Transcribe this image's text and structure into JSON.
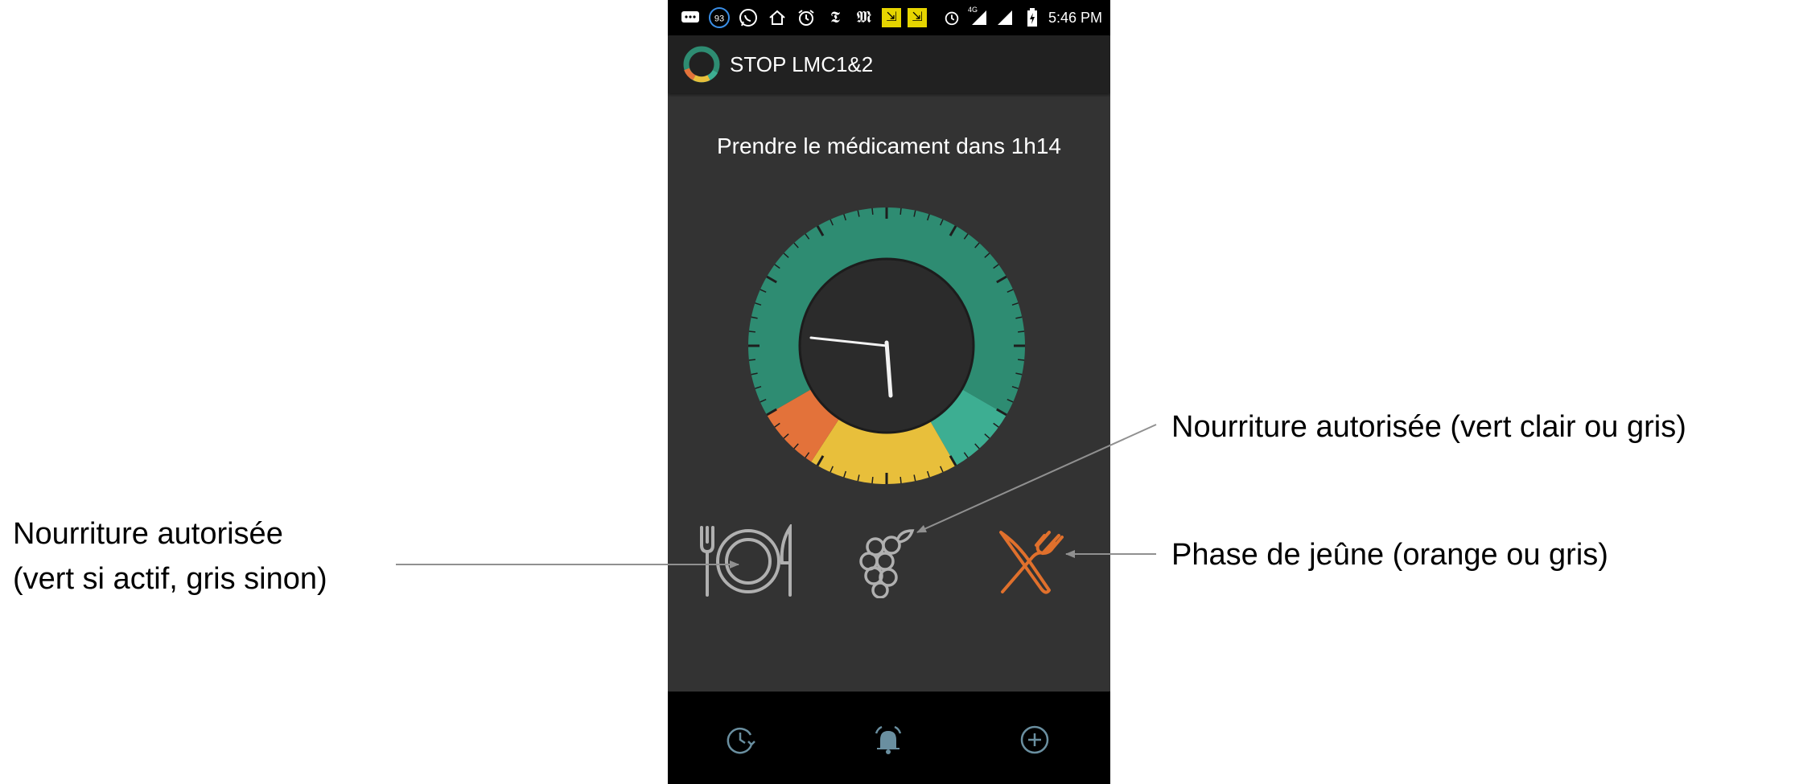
{
  "status_bar": {
    "notification_badge": "93",
    "time": "5:46 PM",
    "network": "4G"
  },
  "app_bar": {
    "title": "STOP LMC1&2"
  },
  "countdown_text": "Prendre le médicament dans 1h14",
  "food_icons": [
    {
      "icon": "plate-fork-knife-icon",
      "state": "gris",
      "color": "#b0b0b0"
    },
    {
      "icon": "grapes-icon",
      "state": "gris",
      "color": "#b0b0b0"
    },
    {
      "icon": "crossed-fork-knife-icon",
      "state": "orange",
      "color": "#e0702c"
    }
  ],
  "bottom_nav": [
    {
      "icon": "history-clock-icon"
    },
    {
      "icon": "alarm-bell-icon"
    },
    {
      "icon": "add-circle-icon"
    }
  ],
  "annotations": {
    "left_line1": "Nourriture autorisée",
    "left_line2": "(vert si actif, gris sinon)",
    "right_top": "Nourriture autorisée (vert clair ou gris)",
    "right_bottom": "Phase de jeûne (orange ou gris)"
  },
  "colors": {
    "phone_bg": "#333333",
    "ring_green": "#2e8c72",
    "ring_light_green": "#3dae92",
    "ring_yellow": "#e8bf3b",
    "ring_orange": "#e3723a",
    "accent_orange": "#e0702c"
  }
}
